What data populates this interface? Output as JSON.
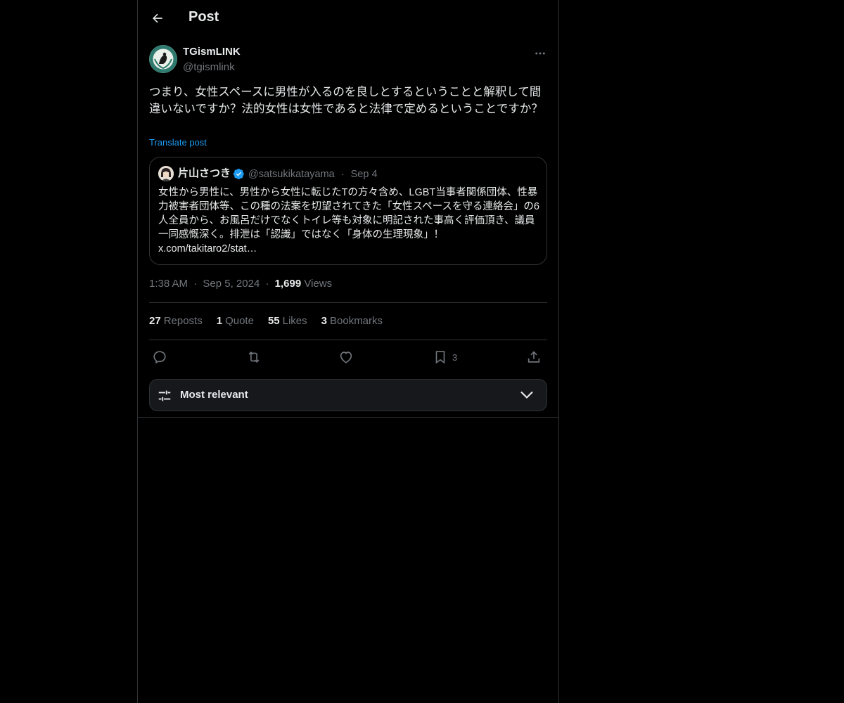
{
  "header": {
    "title": "Post"
  },
  "post": {
    "author_name": "TGismLINK",
    "author_handle": "@tgismlink",
    "text": "つまり、女性スペースに男性が入るのを良しとするということと解釈して間違いないですか？法的女性は女性であると法律で定めるということですか？",
    "translate_label": "Translate post"
  },
  "quote": {
    "author_name": "片山さつき",
    "author_handle": "@satsukikatayama",
    "separator": "·",
    "date": "Sep 4",
    "text": "女性から男性に、男性から女性に転じたTの方々含め、LGBT当事者関係団体、性暴力被害者団体等、この種の法案を切望されてきた「女性スペースを守る連絡会」の6人全員から、お風呂だけでなくトイレ等も対象に明記された事高く評価頂き、議員一同感慨深く。排泄は「認識」ではなく「身体の生理現象」！",
    "link": "x.com/takitaro2/stat…"
  },
  "meta": {
    "time": "1:38 AM",
    "date": "Sep 5, 2024",
    "separator": "·",
    "views_count": "1,699",
    "views_label": "Views"
  },
  "stats": {
    "reposts_count": "27",
    "reposts_label": "Reposts",
    "quotes_count": "1",
    "quotes_label": "Quote",
    "likes_count": "55",
    "likes_label": "Likes",
    "bookmarks_count": "3",
    "bookmarks_label": "Bookmarks"
  },
  "actions": {
    "bookmark_count": "3"
  },
  "sort": {
    "label": "Most relevant"
  },
  "colors": {
    "background": "#000000",
    "text_primary": "#e7e9ea",
    "text_secondary": "#71767b",
    "accent": "#1d9bf0",
    "border": "#2f3336"
  },
  "icons": {
    "back": "arrow-left-icon",
    "more": "more-horizontal-icon",
    "verified": "verified-badge-icon",
    "reply": "reply-icon",
    "repost": "repost-icon",
    "like": "heart-icon",
    "bookmark": "bookmark-icon",
    "share": "share-icon",
    "sort": "sliders-icon",
    "chevron": "chevron-down-icon"
  }
}
